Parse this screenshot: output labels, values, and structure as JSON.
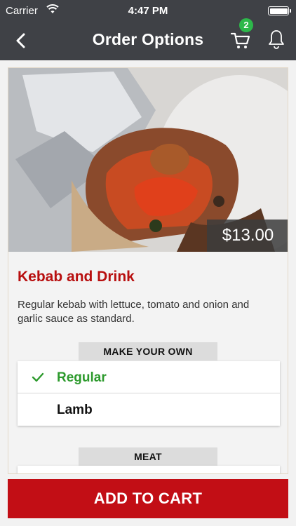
{
  "status_bar": {
    "carrier": "Carrier",
    "time": "4:47 PM",
    "icons": [
      "wifi-icon",
      "battery-icon"
    ]
  },
  "nav": {
    "title": "Order Options",
    "cart_count": "2",
    "icons": [
      "back-chevron-icon",
      "cart-icon",
      "bell-icon"
    ]
  },
  "product": {
    "price": "$13.00",
    "title": "Kebab and Drink",
    "description": "Regular kebab with lettuce, tomato and onion and garlic sauce as standard."
  },
  "option_groups": [
    {
      "label": "MAKE YOUR OWN",
      "options": [
        {
          "label": "Regular",
          "selected": true
        },
        {
          "label": "Lamb",
          "selected": false
        }
      ]
    },
    {
      "label": "MEAT",
      "options": []
    }
  ],
  "actions": {
    "add_to_cart": "ADD TO CART"
  },
  "colors": {
    "nav_background": "#3f4146",
    "accent_red": "#c20e15",
    "title_red": "#b80f0f",
    "selected_green": "#2d9a2d",
    "badge_green": "#2db84a"
  }
}
